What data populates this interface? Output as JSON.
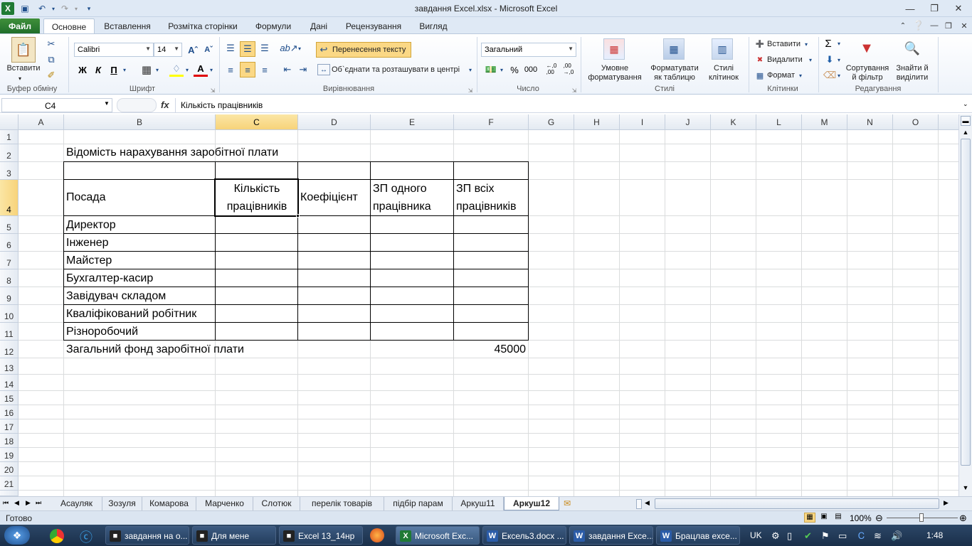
{
  "window": {
    "title": "завдання Excel.xlsx  -  Microsoft Excel"
  },
  "ribbon_tabs": [
    "Файл",
    "Основне",
    "Вставлення",
    "Розмітка сторінки",
    "Формули",
    "Дані",
    "Рецензування",
    "Вигляд"
  ],
  "ribbon": {
    "clipboard": {
      "paste": "Вставити",
      "group": "Буфер обміну"
    },
    "font": {
      "name": "Calibri",
      "size": "14",
      "bold": "Ж",
      "italic": "К",
      "underline": "П",
      "group": "Шрифт"
    },
    "alignment": {
      "wrap": "Перенесення тексту",
      "merge": "Об`єднати та розташувати в центрі",
      "group": "Вирівнювання"
    },
    "number": {
      "format": "Загальний",
      "percent": "%",
      "thousands": "000",
      "group": "Число"
    },
    "styles": {
      "conditional": "Умовне форматування",
      "table": "Форматувати як таблицю",
      "cell": "Стилі клітинок",
      "group": "Стилі"
    },
    "cells": {
      "insert": "Вставити",
      "delete": "Видалити",
      "format": "Формат",
      "group": "Клітинки"
    },
    "editing": {
      "sum": "Σ",
      "sort": "Сортування й фільтр",
      "find": "Знайти й виділити",
      "group": "Редагування"
    }
  },
  "formula_bar": {
    "name_box": "C4",
    "fx": "fx",
    "content": "Кількість працівників"
  },
  "columns": [
    "A",
    "B",
    "C",
    "D",
    "E",
    "F",
    "G",
    "H",
    "I",
    "J",
    "K",
    "L",
    "M",
    "N",
    "O"
  ],
  "rows": [
    "1",
    "2",
    "3",
    "4",
    "5",
    "6",
    "7",
    "8",
    "9",
    "10",
    "11",
    "12",
    "13",
    "14",
    "15",
    "16",
    "17",
    "18",
    "19",
    "20",
    "21"
  ],
  "sheet": {
    "title": "Відомість нарахування заробітної плати",
    "headers": {
      "position": "Посада",
      "count_1": "Кількість",
      "count_2": "працівників",
      "coef": "Коефіцієнт",
      "salary_one_1": "ЗП одного",
      "salary_one_2": "працівника",
      "salary_all_1": "ЗП  всіх",
      "salary_all_2": "працівників"
    },
    "positions": [
      "Директор",
      "Інженер",
      "Майстер",
      "Бухгалтер-касир",
      "Завідувач складом",
      "Кваліфікований робітник",
      "Різноробочий"
    ],
    "total_label": "Загальний фонд заробітної плати",
    "total_value": "45000"
  },
  "sheet_tabs": [
    "Асауляк",
    "Зозуля",
    "Комарова",
    "Марченко",
    "Слотюк",
    "перелік товарів",
    "підбір парам",
    "Аркуш11",
    "Аркуш12"
  ],
  "status": {
    "ready": "Готово",
    "zoom": "100%"
  },
  "taskbar": {
    "items": [
      "завдання на о...",
      "Для мене",
      "Excel 13_14нр",
      "Microsoft Exc...",
      "Ексель3.docx ...",
      "завдання Exce...",
      "Брацлав exce..."
    ],
    "lang": "UK",
    "clock": "1:48"
  }
}
